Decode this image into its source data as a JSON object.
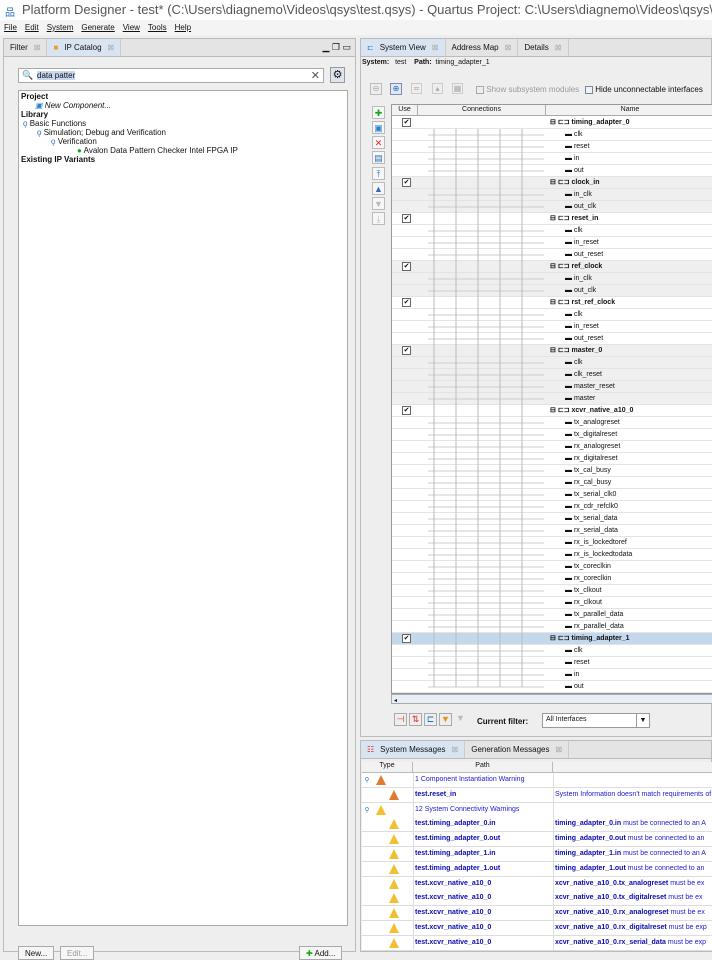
{
  "title": "Platform Designer - test* (C:\\Users\\diagnemo\\Videos\\qsys\\test.qsys) - Quartus Project: C:\\Users\\diagnemo\\Videos\\qsys\\data - data",
  "menu": [
    "File",
    "Edit",
    "System",
    "Generate",
    "View",
    "Tools",
    "Help"
  ],
  "left": {
    "tabs": [
      "Filter",
      "IP Catalog"
    ],
    "search_value": "data patter",
    "tree": {
      "project": "Project",
      "new_component": "New Component...",
      "library": "Library",
      "basic": "Basic Functions",
      "sim": "Simulation; Debug and Verification",
      "verification": "Verification",
      "ip": "Avalon Data Pattern Checker Intel FPGA IP",
      "existing": "Existing IP Variants"
    },
    "buttons": {
      "new": "New...",
      "edit": "Edit...",
      "add": "Add..."
    }
  },
  "system_view": {
    "tabs": [
      "System View",
      "Address Map",
      "Details"
    ],
    "system_label": "System:",
    "system_value": "test",
    "path_label": "Path:",
    "path_value": "timing_adapter_1",
    "show_subsystem": "Show subsystem modules",
    "hide_unconnectable": "Hide unconnectable interfaces",
    "headers": [
      "Use",
      "Connections",
      "Name"
    ],
    "groups": [
      {
        "name": "timing_adapter_0",
        "ports": [
          "clk",
          "reset",
          "in",
          "out"
        ]
      },
      {
        "name": "clock_in",
        "ports": [
          "in_clk",
          "out_clk"
        ]
      },
      {
        "name": "reset_in",
        "ports": [
          "clk",
          "in_reset",
          "out_reset"
        ]
      },
      {
        "name": "ref_clock",
        "ports": [
          "in_clk",
          "out_clk"
        ]
      },
      {
        "name": "rst_ref_clock",
        "ports": [
          "clk",
          "in_reset",
          "out_reset"
        ]
      },
      {
        "name": "master_0",
        "ports": [
          "clk",
          "clk_reset",
          "master_reset",
          "master"
        ]
      },
      {
        "name": "xcvr_native_a10_0",
        "ports": [
          "tx_analogreset",
          "tx_digitalreset",
          "rx_analogreset",
          "rx_digitalreset",
          "tx_cal_busy",
          "rx_cal_busy",
          "tx_serial_clk0",
          "rx_cdr_refclk0",
          "tx_serial_data",
          "rx_serial_data",
          "rx_is_lockedtoref",
          "rx_is_lockedtodata",
          "tx_coreclkin",
          "rx_coreclkin",
          "tx_clkout",
          "rx_clkout",
          "tx_parallel_data",
          "rx_parallel_data"
        ]
      },
      {
        "name": "timing_adapter_1",
        "ports": [
          "clk",
          "reset",
          "in",
          "out"
        ],
        "selected": true
      }
    ],
    "filter_label": "Current filter:",
    "filter_value": "All Interfaces"
  },
  "messages": {
    "tabs": [
      "System Messages",
      "Generation Messages"
    ],
    "headers": [
      "Type",
      "Path"
    ],
    "rows": [
      {
        "level": "group-error",
        "path": "1 Component Instantiation Warning",
        "msg": ""
      },
      {
        "level": "error",
        "path": "test.reset_in",
        "msg": "System Information doesn't match requirements of"
      },
      {
        "level": "group-warn",
        "path": "12 System Connectivity Warnings",
        "msg": ""
      },
      {
        "level": "warn",
        "path": "test.timing_adapter_0.in",
        "msgb": "timing_adapter_0.in",
        "msg": " must be connected to an A"
      },
      {
        "level": "warn",
        "path": "test.timing_adapter_0.out",
        "msgb": "timing_adapter_0.out",
        "msg": " must be connected to an"
      },
      {
        "level": "warn",
        "path": "test.timing_adapter_1.in",
        "msgb": "timing_adapter_1.in",
        "msg": " must be connected to an A"
      },
      {
        "level": "warn",
        "path": "test.timing_adapter_1.out",
        "msgb": "timing_adapter_1.out",
        "msg": " must be connected to an"
      },
      {
        "level": "warn",
        "path": "test.xcvr_native_a10_0",
        "msgb": "xcvr_native_a10_0.tx_analogreset",
        "msg": " must be ex"
      },
      {
        "level": "warn",
        "path": "test.xcvr_native_a10_0",
        "msgb": "xcvr_native_a10_0.tx_digitalreset",
        "msg": " must be ex"
      },
      {
        "level": "warn",
        "path": "test.xcvr_native_a10_0",
        "msgb": "xcvr_native_a10_0.rx_analogreset",
        "msg": " must be ex"
      },
      {
        "level": "warn",
        "path": "test.xcvr_native_a10_0",
        "msgb": "xcvr_native_a10_0.rx_digitalreset",
        "msg": " must be exp"
      },
      {
        "level": "warn",
        "path": "test.xcvr_native_a10_0",
        "msgb": "xcvr_native_a10_0.rx_serial_data",
        "msg": " must be exp"
      }
    ]
  }
}
